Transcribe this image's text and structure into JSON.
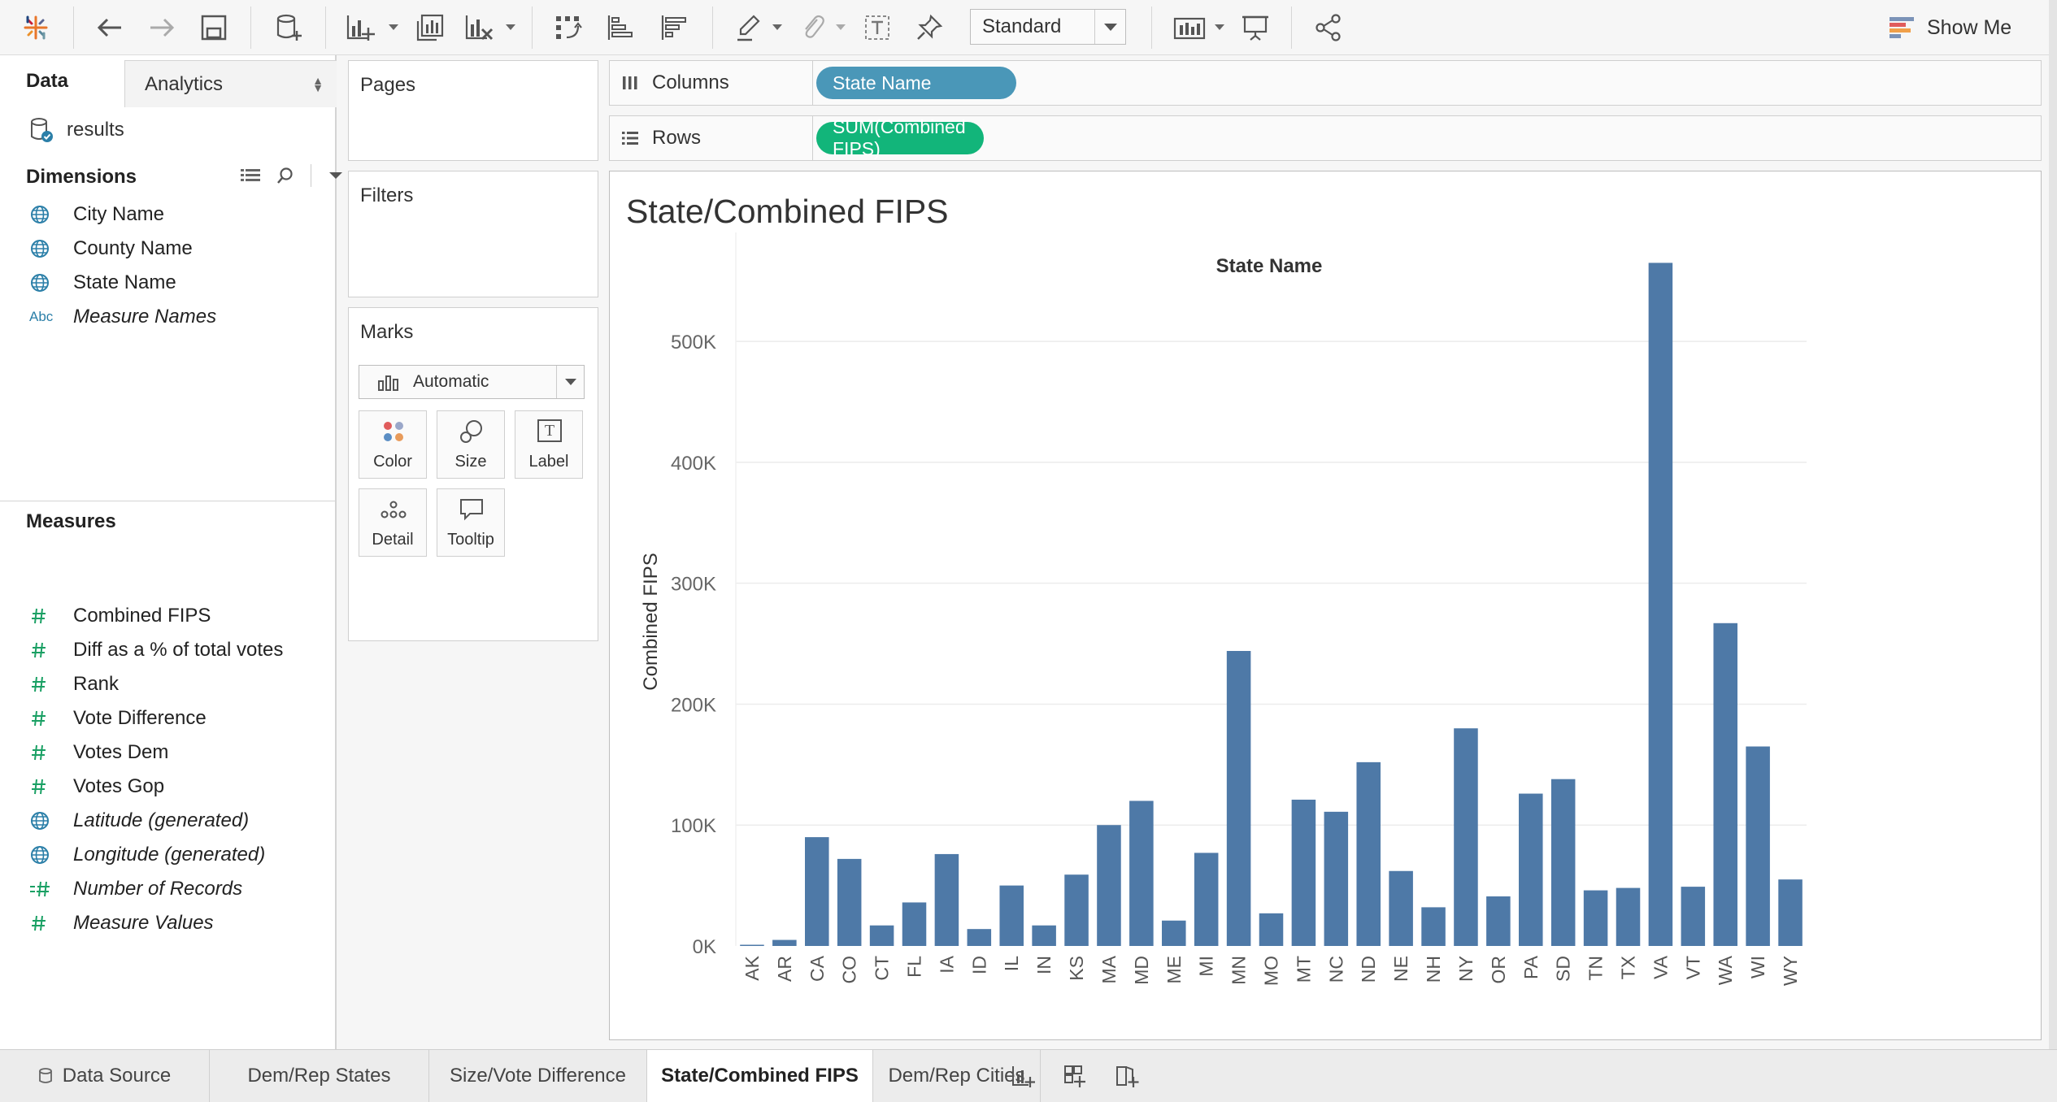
{
  "toolbar": {
    "icons": [
      "tableau-logo-icon",
      "undo-icon",
      "redo-icon",
      "save-icon",
      "new-datasource-icon",
      "new-worksheet-icon",
      "duplicate-sheet-icon",
      "clear-sheet-icon",
      "swap-axes-icon",
      "sort-ascending-icon",
      "sort-descending-icon",
      "highlight-icon",
      "attach-icon",
      "text-icon",
      "pin-icon",
      "show-cards-icon",
      "presentation-icon",
      "share-icon"
    ],
    "fit_value": "Standard",
    "show_me_label": "Show Me"
  },
  "data_pane": {
    "tabs": {
      "data": "Data",
      "analytics": "Analytics"
    },
    "datasource": "results",
    "dimensions_title": "Dimensions",
    "dimensions": [
      {
        "label": "City Name",
        "icon": "globe-icon"
      },
      {
        "label": "County Name",
        "icon": "globe-icon"
      },
      {
        "label": "State Name",
        "icon": "globe-icon"
      },
      {
        "label": "Measure Names",
        "icon": "abc-icon",
        "abc": "Abc"
      }
    ],
    "measures_title": "Measures",
    "measures": [
      {
        "label": "Combined FIPS",
        "icon": "hash-icon"
      },
      {
        "label": "Diff as a % of total votes",
        "icon": "hash-icon"
      },
      {
        "label": "Rank",
        "icon": "hash-icon"
      },
      {
        "label": "Vote Difference",
        "icon": "hash-icon"
      },
      {
        "label": "Votes Dem",
        "icon": "hash-icon"
      },
      {
        "label": "Votes Gop",
        "icon": "hash-icon"
      },
      {
        "label": "Latitude (generated)",
        "icon": "globe-icon"
      },
      {
        "label": "Longitude (generated)",
        "icon": "globe-icon"
      },
      {
        "label": "Number of Records",
        "icon": "calc-hash-icon"
      },
      {
        "label": "Measure Values",
        "icon": "hash-icon"
      }
    ]
  },
  "cards": {
    "pages": "Pages",
    "filters": "Filters",
    "marks": "Marks",
    "mark_type": "Automatic",
    "mark_buttons": {
      "color": "Color",
      "size": "Size",
      "label": "Label",
      "detail": "Detail",
      "tooltip": "Tooltip"
    },
    "label_glyph": "T"
  },
  "shelves": {
    "columns_label": "Columns",
    "columns_pill": "State Name",
    "rows_label": "Rows",
    "rows_pill": "SUM(Combined FIPS)"
  },
  "colors": {
    "bar": "#4e79a7",
    "dimension_pill": "#4a97b8",
    "measure_pill": "#12b57a",
    "globe_icon": "#2b7fa8",
    "hash_icon": "#1aa064"
  },
  "chart_data": {
    "type": "bar",
    "title": "State/Combined FIPS",
    "xlabel": "State Name",
    "ylabel": "Combined FIPS",
    "ylim": [
      0,
      570000
    ],
    "yticks": [
      0,
      100000,
      200000,
      300000,
      400000,
      500000
    ],
    "ytick_labels": [
      "0K",
      "100K",
      "200K",
      "300K",
      "400K",
      "500K"
    ],
    "grid": true,
    "categories": [
      "AK",
      "AR",
      "CA",
      "CO",
      "CT",
      "FL",
      "IA",
      "ID",
      "IL",
      "IN",
      "KS",
      "MA",
      "MD",
      "ME",
      "MI",
      "MN",
      "MO",
      "MT",
      "NC",
      "ND",
      "NE",
      "NH",
      "NY",
      "OR",
      "PA",
      "SD",
      "TN",
      "TX",
      "VA",
      "VT",
      "WA",
      "WI",
      "WY"
    ],
    "values": [
      1000,
      5000,
      90000,
      72000,
      17000,
      36000,
      76000,
      14000,
      50000,
      17000,
      59000,
      100000,
      120000,
      21000,
      77000,
      244000,
      27000,
      121000,
      111000,
      152000,
      62000,
      32000,
      180000,
      41000,
      126000,
      138000,
      46000,
      48000,
      565000,
      49000,
      267000,
      165000,
      55000
    ]
  },
  "sheet_tabs": {
    "datasource": "Data Source",
    "sheets": [
      "Dem/Rep States",
      "Size/Vote Difference",
      "State/Combined FIPS",
      "Dem/Rep Cities"
    ],
    "active": "State/Combined FIPS"
  }
}
